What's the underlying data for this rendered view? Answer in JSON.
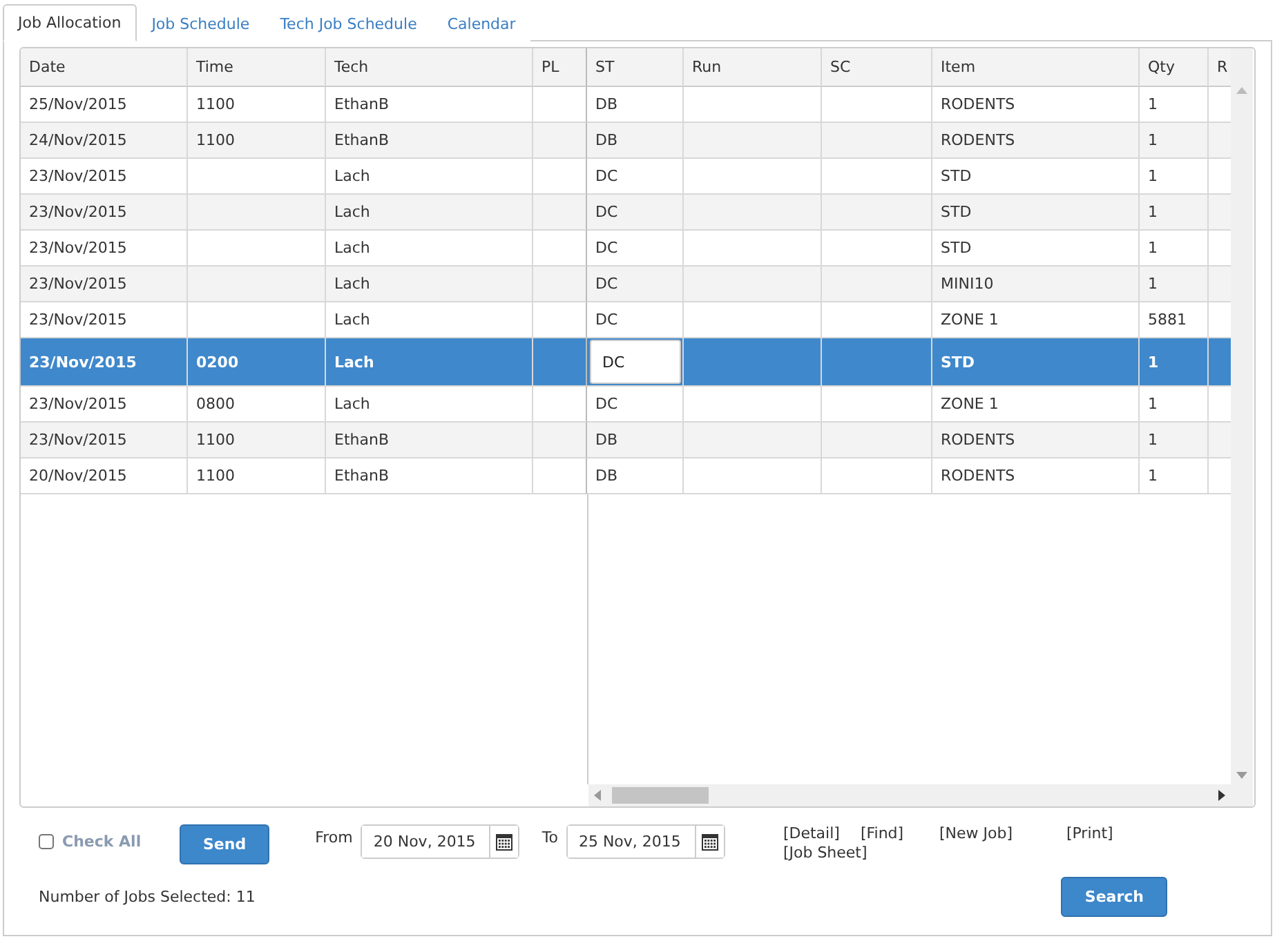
{
  "tabs": [
    {
      "label": "Job Allocation",
      "selected": true
    },
    {
      "label": "Job Schedule",
      "selected": false
    },
    {
      "label": "Tech Job Schedule",
      "selected": false
    },
    {
      "label": "Calendar",
      "selected": false
    }
  ],
  "table": {
    "frozen_columns": [
      "Date",
      "Time",
      "Tech",
      "PL"
    ],
    "scroll_columns": [
      "ST",
      "Run",
      "SC",
      "Item",
      "Qty",
      "R"
    ],
    "rows": [
      {
        "date": "25/Nov/2015",
        "time": "1100",
        "tech": "EthanB",
        "st": "DB",
        "item": "RODENTS",
        "qty": "1",
        "selected": false,
        "editing": false
      },
      {
        "date": "24/Nov/2015",
        "time": "1100",
        "tech": "EthanB",
        "st": "DB",
        "item": "RODENTS",
        "qty": "1",
        "selected": false,
        "editing": false
      },
      {
        "date": "23/Nov/2015",
        "tech": "Lach",
        "st": "DC",
        "item": "STD",
        "qty": "1",
        "selected": false,
        "editing": false
      },
      {
        "date": "23/Nov/2015",
        "tech": "Lach",
        "st": "DC",
        "item": "STD",
        "qty": "1",
        "selected": false,
        "editing": false
      },
      {
        "date": "23/Nov/2015",
        "tech": "Lach",
        "st": "DC",
        "item": "STD",
        "qty": "1",
        "selected": false,
        "editing": false
      },
      {
        "date": "23/Nov/2015",
        "tech": "Lach",
        "st": "DC",
        "item": "MINI10",
        "qty": "1",
        "selected": false,
        "editing": false
      },
      {
        "date": "23/Nov/2015",
        "tech": "Lach",
        "st": "DC",
        "item": "ZONE 1",
        "qty": "5881",
        "selected": false,
        "editing": false
      },
      {
        "date": "23/Nov/2015",
        "time": "0200",
        "tech": "Lach",
        "st": "DC",
        "item": "STD",
        "qty": "1",
        "selected": true,
        "editing": true
      },
      {
        "date": "23/Nov/2015",
        "time": "0800",
        "tech": "Lach",
        "st": "DC",
        "item": "ZONE 1",
        "qty": "1",
        "selected": false,
        "editing": false
      },
      {
        "date": "23/Nov/2015",
        "time": "1100",
        "tech": "EthanB",
        "st": "DB",
        "item": "RODENTS",
        "qty": "1",
        "selected": false,
        "editing": false
      },
      {
        "date": "20/Nov/2015",
        "time": "1100",
        "tech": "EthanB",
        "st": "DB",
        "item": "RODENTS",
        "qty": "1",
        "selected": false,
        "editing": false
      }
    ]
  },
  "footer": {
    "check_all": {
      "label": "Check All",
      "checked": false
    },
    "send_button": "Send",
    "from": {
      "label": "From",
      "value": "20 Nov, 2015"
    },
    "to": {
      "label": "To",
      "value": "25 Nov, 2015"
    },
    "links": [
      "[Detail]",
      "[Find]",
      "[New Job]",
      "[Print]",
      "[Job Sheet]"
    ],
    "jobs_selected": "Number of Jobs Selected: 11",
    "search_button": "Search"
  }
}
